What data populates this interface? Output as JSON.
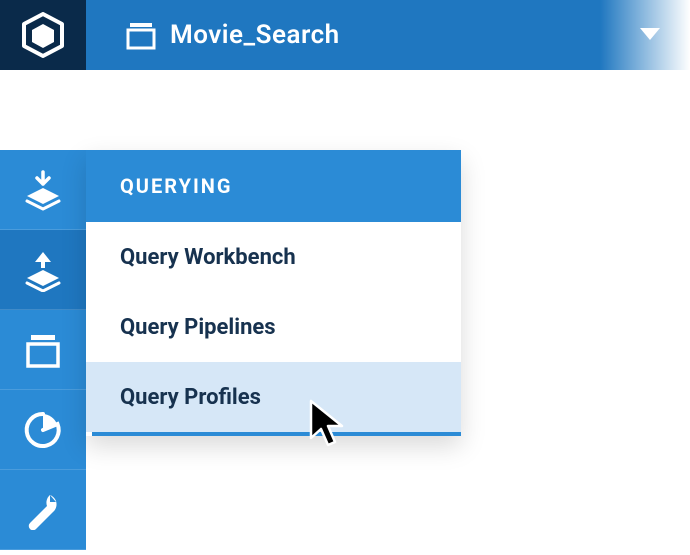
{
  "header": {
    "app_name": "Movie_Search"
  },
  "flyout": {
    "title": "QUERYING",
    "items": [
      {
        "label": "Query Workbench"
      },
      {
        "label": "Query Pipelines"
      },
      {
        "label": "Query Profiles"
      }
    ],
    "hovered_index": 2
  },
  "sidebar": {
    "items": [
      {
        "name": "ingest",
        "icon": "layers-down-icon"
      },
      {
        "name": "querying",
        "icon": "layers-up-icon",
        "active": true
      },
      {
        "name": "collections",
        "icon": "stack-icon"
      },
      {
        "name": "analytics",
        "icon": "pie-chart-icon"
      },
      {
        "name": "settings",
        "icon": "wrench-icon"
      }
    ]
  },
  "colors": {
    "brand_dark": "#0a2a4a",
    "brand_primary": "#1f77c0",
    "brand_light": "#2b8bd6",
    "hover_bg": "#d6e7f7",
    "text_dark": "#17324f"
  }
}
